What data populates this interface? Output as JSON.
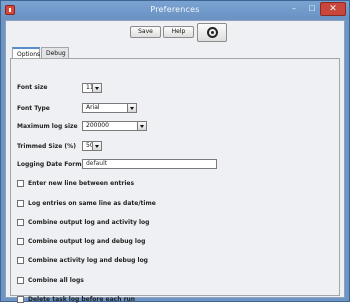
{
  "window": {
    "title": "Preferences",
    "controls": {
      "minimize": "–",
      "maximize": "□",
      "close": "✕"
    }
  },
  "toolbar": {
    "save_label": "Save",
    "help_label": "Help",
    "about_icon": "power-icon"
  },
  "tabs": [
    {
      "label": "Options",
      "active": true
    },
    {
      "label": "Debug",
      "active": false
    }
  ],
  "options": {
    "font_size": {
      "label": "Font size",
      "value": "11"
    },
    "font_type": {
      "label": "Font Type",
      "value": "Arial"
    },
    "max_log_size": {
      "label": "Maximum log size",
      "value": "200000"
    },
    "trimmed_size": {
      "label": "Trimmed Size (%)",
      "value": "50"
    },
    "date_format": {
      "label": "Logging Date Format",
      "value": "default"
    },
    "checkboxes": [
      {
        "label": "Enter new line between entries",
        "checked": false
      },
      {
        "label": "Log entries on same line as date/time",
        "checked": false
      },
      {
        "label": "Combine output log and activity log",
        "checked": false
      },
      {
        "label": "Combine output log and debug log",
        "checked": false
      },
      {
        "label": "Combine activity log and debug log",
        "checked": false
      },
      {
        "label": "Combine all logs",
        "checked": false
      },
      {
        "label": "Delete task log before each run",
        "checked": false
      }
    ]
  },
  "colors": {
    "titlebar": "#6d94c2",
    "close_button": "#c8463b",
    "panel_bg": "#eef0f3"
  }
}
